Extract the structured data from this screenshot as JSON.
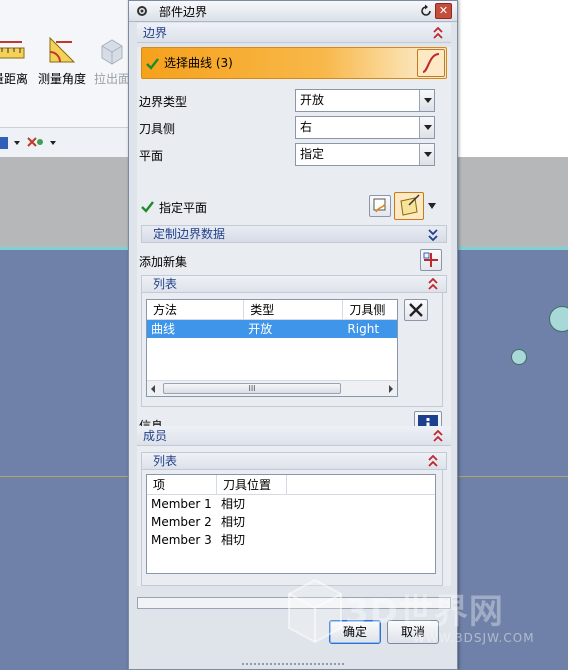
{
  "background_app": {
    "tools": [
      {
        "label": "量距离",
        "icon": "measure-distance-icon"
      },
      {
        "label": "测量角度",
        "icon": "measure-angle-icon"
      },
      {
        "label": "拉出面",
        "icon": "pull-face-icon"
      }
    ]
  },
  "dialog": {
    "title": "部件边界",
    "boundary_section": {
      "title": "边界",
      "select_curve_label": "选择曲线 (3)",
      "fields": [
        {
          "label": "边界类型",
          "value": "开放"
        },
        {
          "label": "刀具侧",
          "value": "右"
        },
        {
          "label": "平面",
          "value": "指定"
        }
      ],
      "specify_plane_label": "指定平面",
      "custom_data_label": "定制边界数据",
      "add_new_set_label": "添加新集",
      "list": {
        "title": "列表",
        "columns": [
          "方法",
          "类型",
          "刀具侧"
        ],
        "rows": [
          {
            "method": "曲线",
            "type": "开放",
            "side": "Right",
            "selected": true
          }
        ],
        "scroll_grip": "III"
      },
      "info_label": "信息"
    },
    "members_section": {
      "title": "成员",
      "list": {
        "title": "列表",
        "columns": [
          "项",
          "刀具位置"
        ],
        "rows": [
          {
            "item": "Member 1",
            "position": "相切"
          },
          {
            "item": "Member 2",
            "position": "相切"
          },
          {
            "item": "Member 3",
            "position": "相切"
          }
        ]
      }
    },
    "ok_label": "确定",
    "cancel_label": "取消"
  },
  "watermark": {
    "text": "3D世界网",
    "url": "WWW.3DSJW.COM"
  },
  "colors": {
    "accent_orange": "#f6a11b",
    "selection_blue": "#3f95e9",
    "section_title": "#23408a",
    "viewport_blue": "#6f81a8"
  }
}
